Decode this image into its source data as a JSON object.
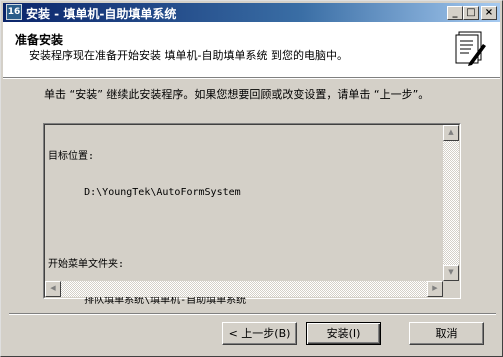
{
  "window": {
    "title": "安装 - 填单机-自助填单系统",
    "app_icon_text": "16",
    "controls": {
      "minimize": "_",
      "maximize": "□",
      "close": "×"
    }
  },
  "header": {
    "title": "准备安装",
    "description": "安装程序现在准备开始安装 填单机-自助填单系统 到您的电脑中。"
  },
  "instruction": "单击 “安装” 继续此安装程序。如果您想要回顾或改变设置，请单击 “上一步”。",
  "memo": {
    "lines": [
      "目标位置:",
      "      D:\\YoungTek\\AutoFormSystem",
      "",
      "开始菜单文件夹:",
      "      排队填单系统\\填单机-自助填单系统"
    ]
  },
  "buttons": {
    "back": "< 上一步(B)",
    "install": "安装(I)",
    "cancel": "取消"
  }
}
